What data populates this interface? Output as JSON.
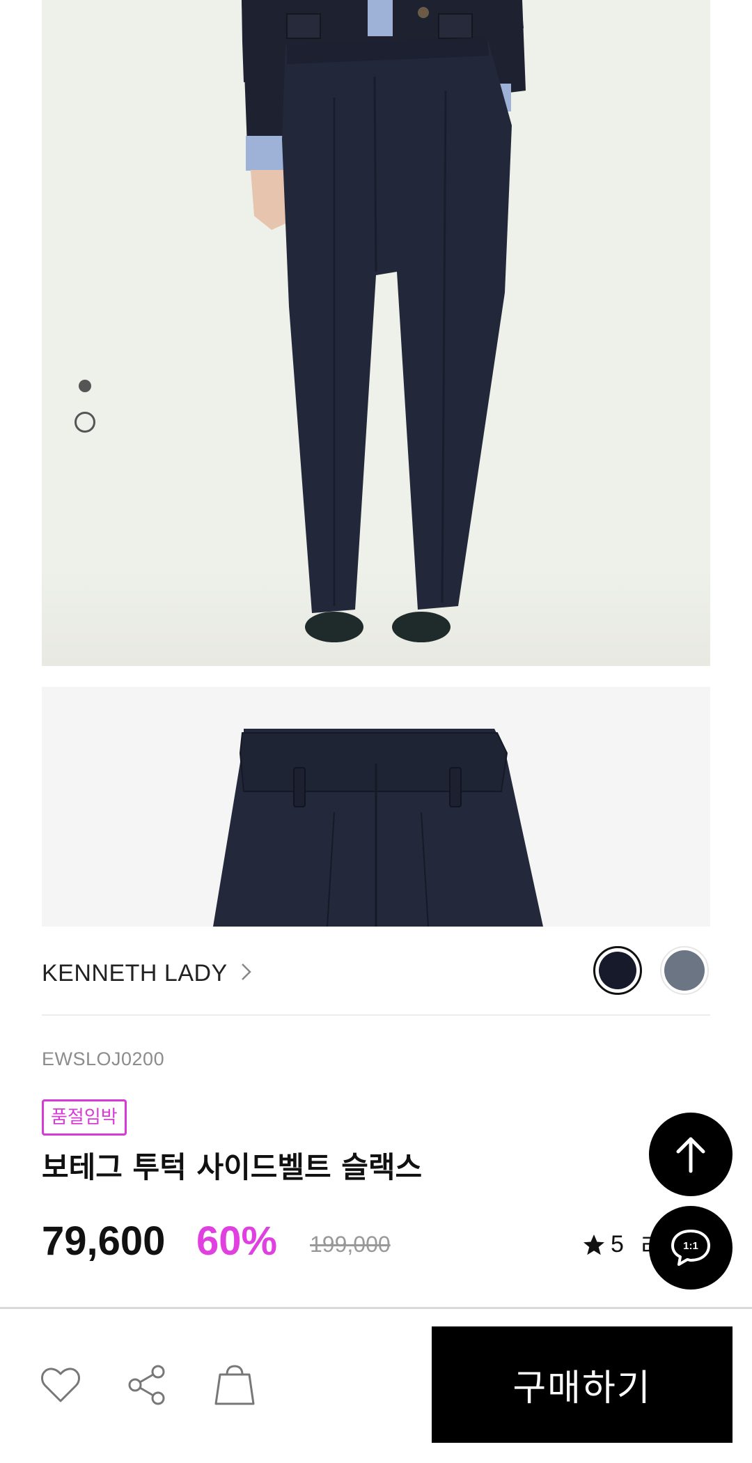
{
  "product": {
    "brand": "KENNETH LADY",
    "sku": "EWSLOJ0200",
    "badge": "품절임박",
    "title": "보테그 투턱 사이드벨트 슬랙스",
    "price": "79,600",
    "discount": "60%",
    "original_price": "199,000",
    "rating": "5",
    "review_label": "리"
  },
  "gallery": {
    "total_images": 2,
    "active_index": 1
  },
  "colors": {
    "swatches": [
      "#161a2a",
      "#6c7584"
    ],
    "selected_index": 0,
    "discount_accent": "#e040e0",
    "badge_accent": "#d63bd6"
  },
  "floating": {
    "top_icon": "arrow-up-icon",
    "chat_icon": "chat-1to1-icon",
    "chat_label": "1:1"
  },
  "bottom_bar": {
    "buy_label": "구매하기",
    "icons": [
      "heart-icon",
      "share-icon",
      "shopping-bag-icon"
    ]
  }
}
